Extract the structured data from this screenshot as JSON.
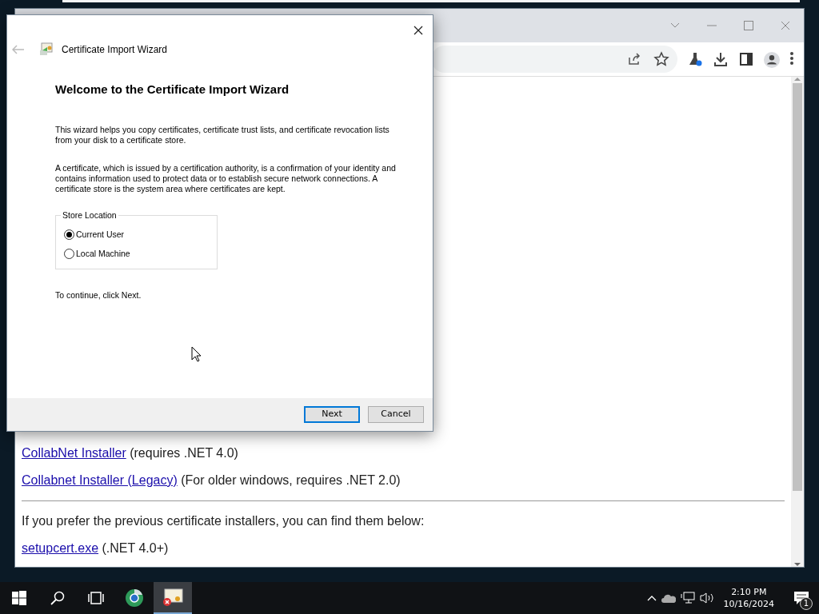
{
  "browser": {
    "content": [
      {
        "kind": "text",
        "parts": [
          {
            "kind": "link",
            "text": "CollabNet Installer"
          },
          {
            "kind": "text",
            "text": " (requires .NET 4.0)"
          }
        ]
      },
      {
        "kind": "text",
        "parts": [
          {
            "kind": "link",
            "text": "Collabnet Installer (Legacy)"
          },
          {
            "kind": "text",
            "text": " (For older windows, requires .NET 2.0)"
          }
        ]
      },
      {
        "kind": "rule"
      },
      {
        "kind": "text",
        "parts": [
          {
            "kind": "text",
            "text": "If you prefer the previous certificate installers, you can find them below:"
          }
        ]
      },
      {
        "kind": "text",
        "parts": [
          {
            "kind": "link",
            "text": "setupcert.exe"
          },
          {
            "kind": "text",
            "text": " (.NET 4.0+)"
          }
        ]
      }
    ]
  },
  "dialog": {
    "title": "Certificate Import Wizard",
    "heading": "Welcome to the Certificate Import Wizard",
    "paragraphs": [
      "This wizard helps you copy certificates, certificate trust lists, and certificate revocation lists from your disk to a certificate store.",
      "A certificate, which is issued by a certification authority, is a confirmation of your identity and contains information used to protect data or to establish secure network connections. A certificate store is the system area where certificates are kept."
    ],
    "store_location": {
      "label": "Store Location",
      "options": [
        {
          "label": "Current User",
          "selected": true
        },
        {
          "label": "Local Machine",
          "selected": false
        }
      ]
    },
    "footer_text": "To continue, click Next.",
    "buttons": [
      {
        "label": "Next",
        "default": true
      },
      {
        "label": "Cancel",
        "default": false
      }
    ]
  },
  "taskbar": {
    "apps": [
      {
        "kind": "globe",
        "active": false
      },
      {
        "kind": "certificate",
        "active": true
      }
    ],
    "time": "2:10 PM",
    "date": "10/16/2024",
    "notifications": "1"
  }
}
